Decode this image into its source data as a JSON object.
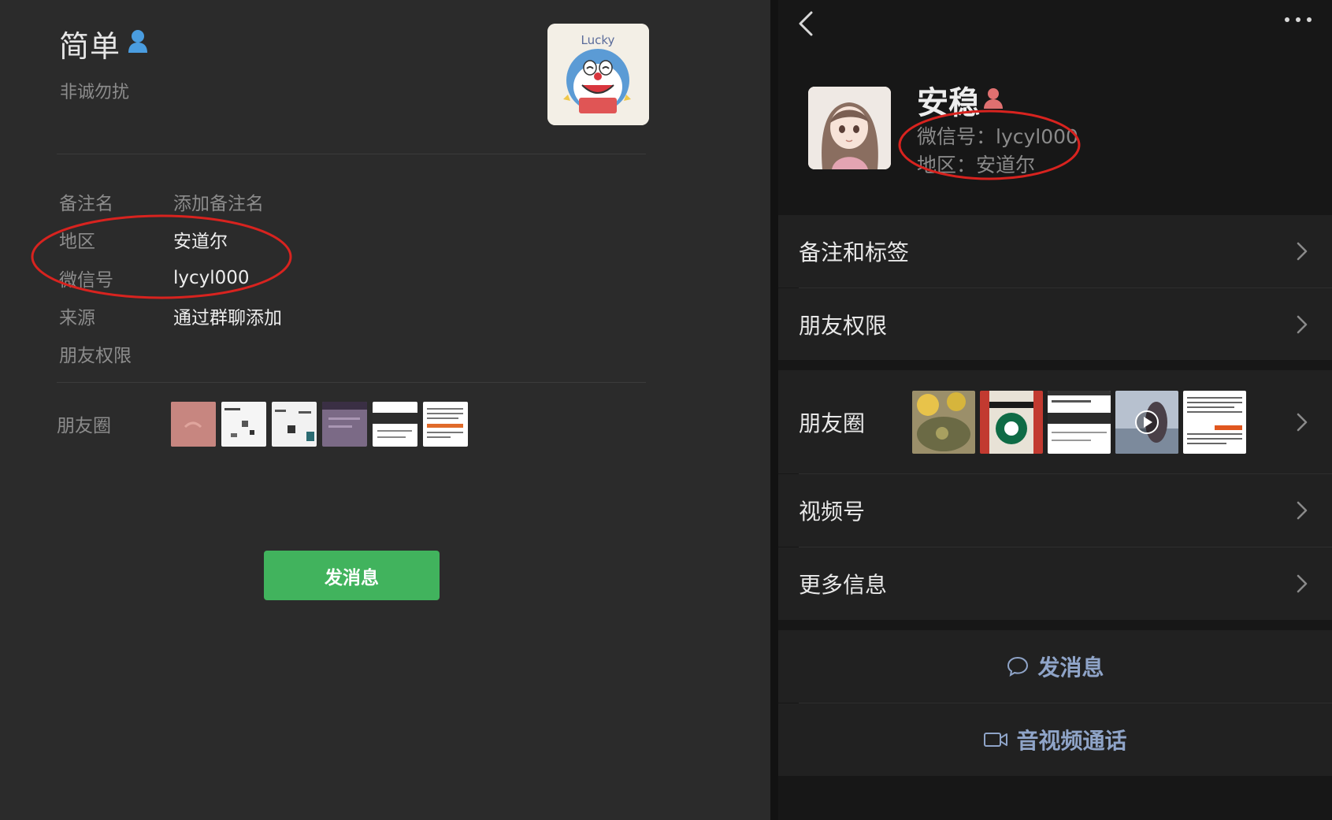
{
  "left_panel": {
    "name": "简单",
    "signature": "非诚勿扰",
    "fields": [
      {
        "key": "备注名",
        "value": "添加备注名"
      },
      {
        "key": "地区",
        "value": "安道尔"
      },
      {
        "key": "微信号",
        "value": "lycyl000"
      },
      {
        "key": "来源",
        "value": "通过群聊添加"
      },
      {
        "key": "朋友权限",
        "value": ""
      }
    ],
    "moments_label": "朋友圈",
    "send_button": "发消息",
    "avatar_text": "Lucky"
  },
  "right_panel": {
    "name": "安稳",
    "wechat_id": "微信号：lycyl000",
    "region": "地区：安道尔",
    "rows": {
      "remarks": "备注和标签",
      "permissions": "朋友权限",
      "moments": "朋友圈",
      "channels": "视频号",
      "more_info": "更多信息"
    },
    "send_message": "发消息",
    "av_call": "音视频通话"
  },
  "colors": {
    "left_bg": "#2b2b2b",
    "right_bg": "#171717",
    "row_bg": "#212121",
    "send_green": "#41b35d",
    "action_blue": "#8fa4c8",
    "annotation_red": "#d8231f",
    "male_icon": "#4a9de0",
    "female_icon": "#e07070"
  },
  "icons": [
    "male-gender-icon",
    "female-gender-icon",
    "back-arrow-icon",
    "more-dots-icon",
    "chevron-right-icon",
    "chat-bubble-icon",
    "video-camera-icon",
    "play-icon"
  ]
}
